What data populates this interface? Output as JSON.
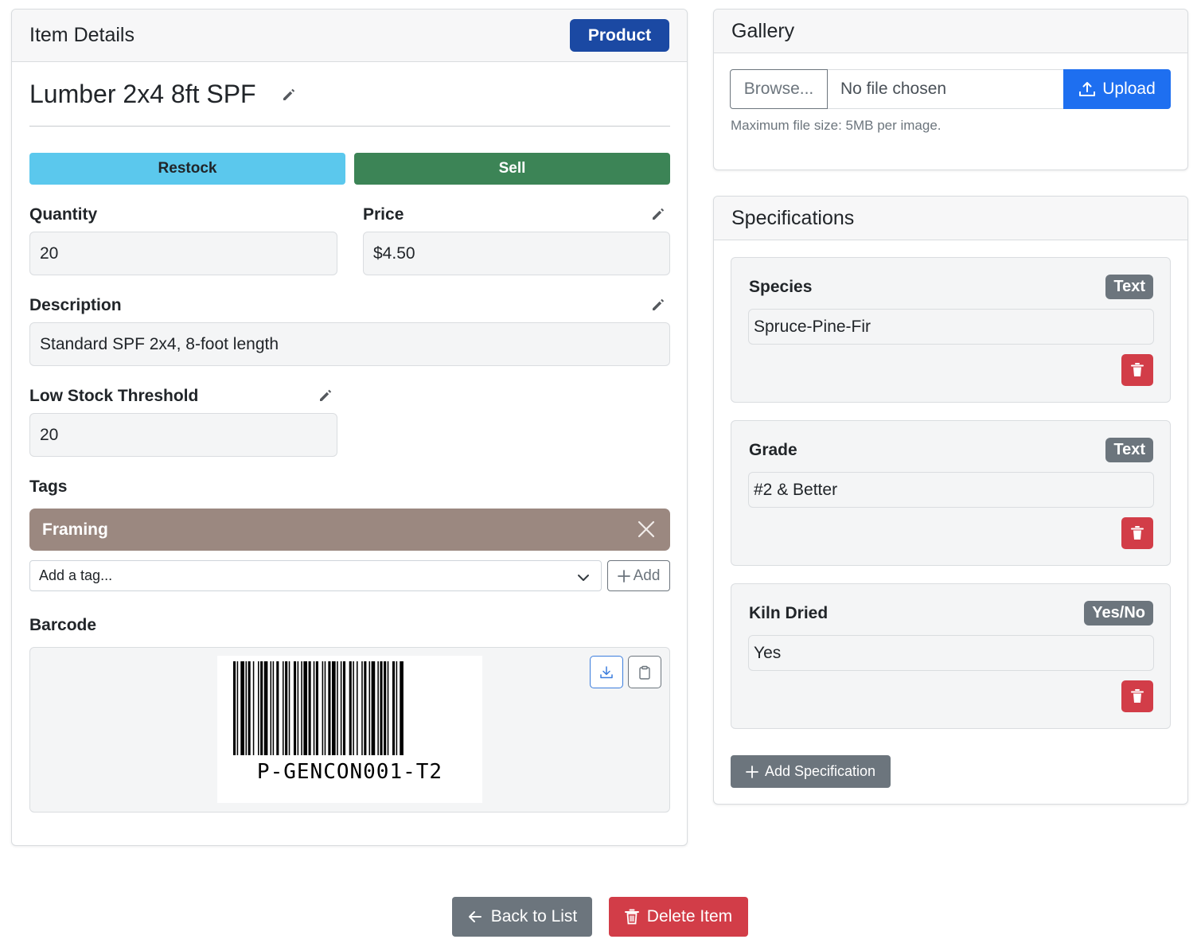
{
  "item_details": {
    "header_title": "Item Details",
    "type_badge": "Product",
    "name": "Lumber 2x4 8ft SPF",
    "restock_label": "Restock",
    "sell_label": "Sell",
    "quantity_label": "Quantity",
    "quantity_value": "20",
    "price_label": "Price",
    "price_value": "$4.50",
    "description_label": "Description",
    "description_value": "Standard SPF 2x4, 8-foot length",
    "threshold_label": "Low Stock Threshold",
    "threshold_value": "20",
    "tags_label": "Tags",
    "tags": [
      "Framing"
    ],
    "tag_select_placeholder": "Add a tag...",
    "tag_add_label": "Add",
    "barcode_label": "Barcode",
    "barcode_value": "P-GENCON001-T2"
  },
  "gallery": {
    "header_title": "Gallery",
    "browse_label": "Browse...",
    "file_status": "No file chosen",
    "upload_label": "Upload",
    "help_text": "Maximum file size: 5MB per image."
  },
  "specifications": {
    "header_title": "Specifications",
    "items": [
      {
        "name": "Species",
        "type": "Text",
        "value": "Spruce-Pine-Fir"
      },
      {
        "name": "Grade",
        "type": "Text",
        "value": "#2 & Better"
      },
      {
        "name": "Kiln Dried",
        "type": "Yes/No",
        "value": "Yes"
      }
    ],
    "add_label": "Add Specification"
  },
  "actions": {
    "back_label": "Back to List",
    "delete_label": "Delete Item"
  },
  "colors": {
    "product_badge": "#1b49a3",
    "restock": "#5bc8ed",
    "sell": "#3c8456",
    "tag_framing": "#9b8880",
    "upload": "#1e6ff0",
    "danger": "#d23d48",
    "secondary": "#6c757d"
  },
  "icons": [
    "pencil-icon",
    "close-icon",
    "chevron-down-icon",
    "plus-icon",
    "download-icon",
    "clipboard-icon",
    "upload-icon",
    "trash-icon",
    "arrow-left-icon"
  ]
}
